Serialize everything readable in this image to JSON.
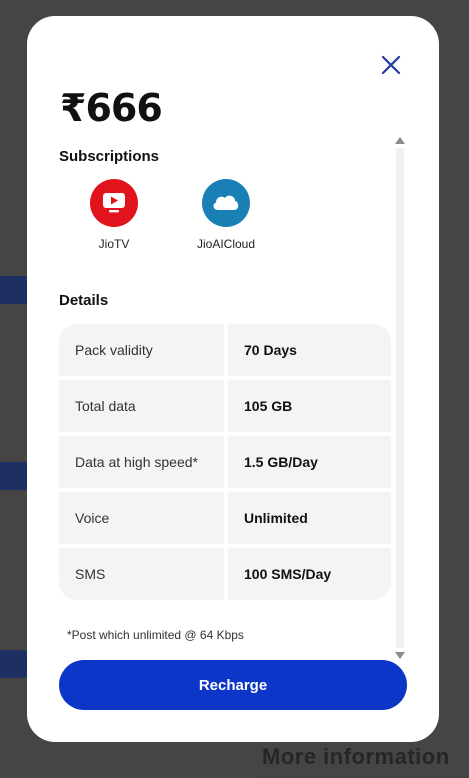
{
  "background": {
    "footer_text": "More information"
  },
  "plan": {
    "price": "₹666"
  },
  "subscriptions": {
    "title": "Subscriptions",
    "items": [
      {
        "label": "JioTV",
        "icon": "play-tv-icon",
        "color": "#e1141e"
      },
      {
        "label": "JioAICloud",
        "icon": "cloud-icon",
        "color": "#1a7fb4"
      }
    ]
  },
  "details": {
    "title": "Details",
    "rows": [
      {
        "key": "Pack validity",
        "value": "70 Days"
      },
      {
        "key": "Total data",
        "value": "105 GB"
      },
      {
        "key": "Data at high speed*",
        "value": "1.5 GB/Day"
      },
      {
        "key": "Voice",
        "value": "Unlimited"
      },
      {
        "key": "SMS",
        "value": "100 SMS/Day"
      }
    ]
  },
  "footnote": "*Post which unlimited @ 64 Kbps",
  "actions": {
    "recharge_label": "Recharge",
    "close_icon": "close-icon"
  },
  "colors": {
    "primary": "#0c36c7",
    "close": "#1f3aa0"
  }
}
